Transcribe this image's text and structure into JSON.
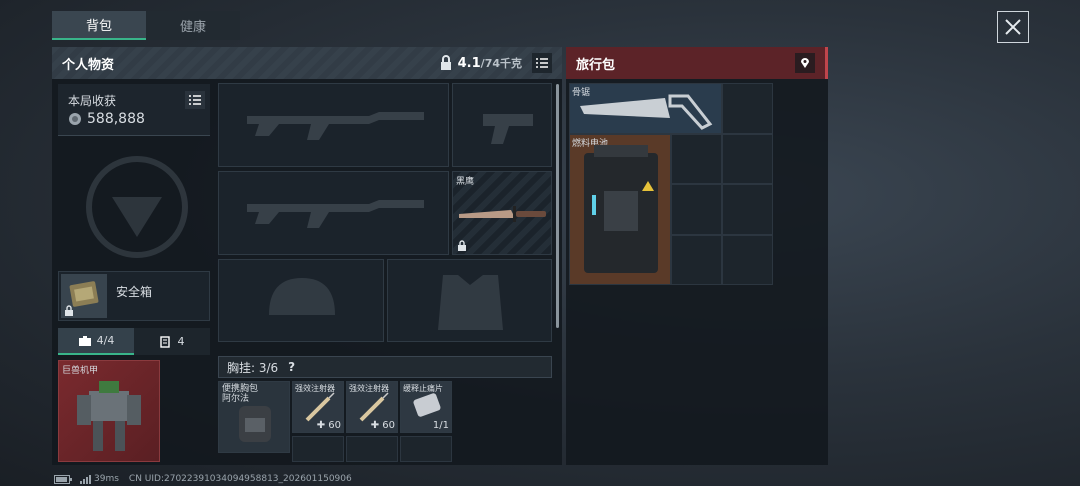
{
  "tabs": [
    {
      "label": "背包"
    },
    {
      "label": "健康"
    }
  ],
  "personal": {
    "title": "个人物资",
    "weight": "4.1",
    "weight_cap": "/74千克"
  },
  "earnings": {
    "label": "本局收获",
    "value": "588,888"
  },
  "safebox": {
    "label": "安全箱"
  },
  "subtabs": {
    "a": "4/4",
    "b": "4"
  },
  "mech": {
    "label": "巨兽机甲"
  },
  "blackhawk": {
    "label": "黑鹰"
  },
  "chest": {
    "label": "胸挂: 3/6",
    "help": "?"
  },
  "items": [
    {
      "label": "便携胸包\n阿尔法",
      "count": ""
    },
    {
      "label": "强效注射器",
      "count": "60"
    },
    {
      "label": "强效注射器",
      "count": "60"
    },
    {
      "label": "缓释止痛片",
      "count": "1/1"
    }
  ],
  "travel": {
    "title": "旅行包",
    "saw": "骨锯",
    "battery": "燃料电池"
  },
  "status": {
    "ping": "39ms",
    "uid": "CN UID:2702239103409495881​3_202601150906"
  },
  "colors": {
    "green": "#39b58a",
    "red_panel": "#7a2a30",
    "blue_slot": "#2a3c4d",
    "brown_slot": "#5a3a28"
  }
}
